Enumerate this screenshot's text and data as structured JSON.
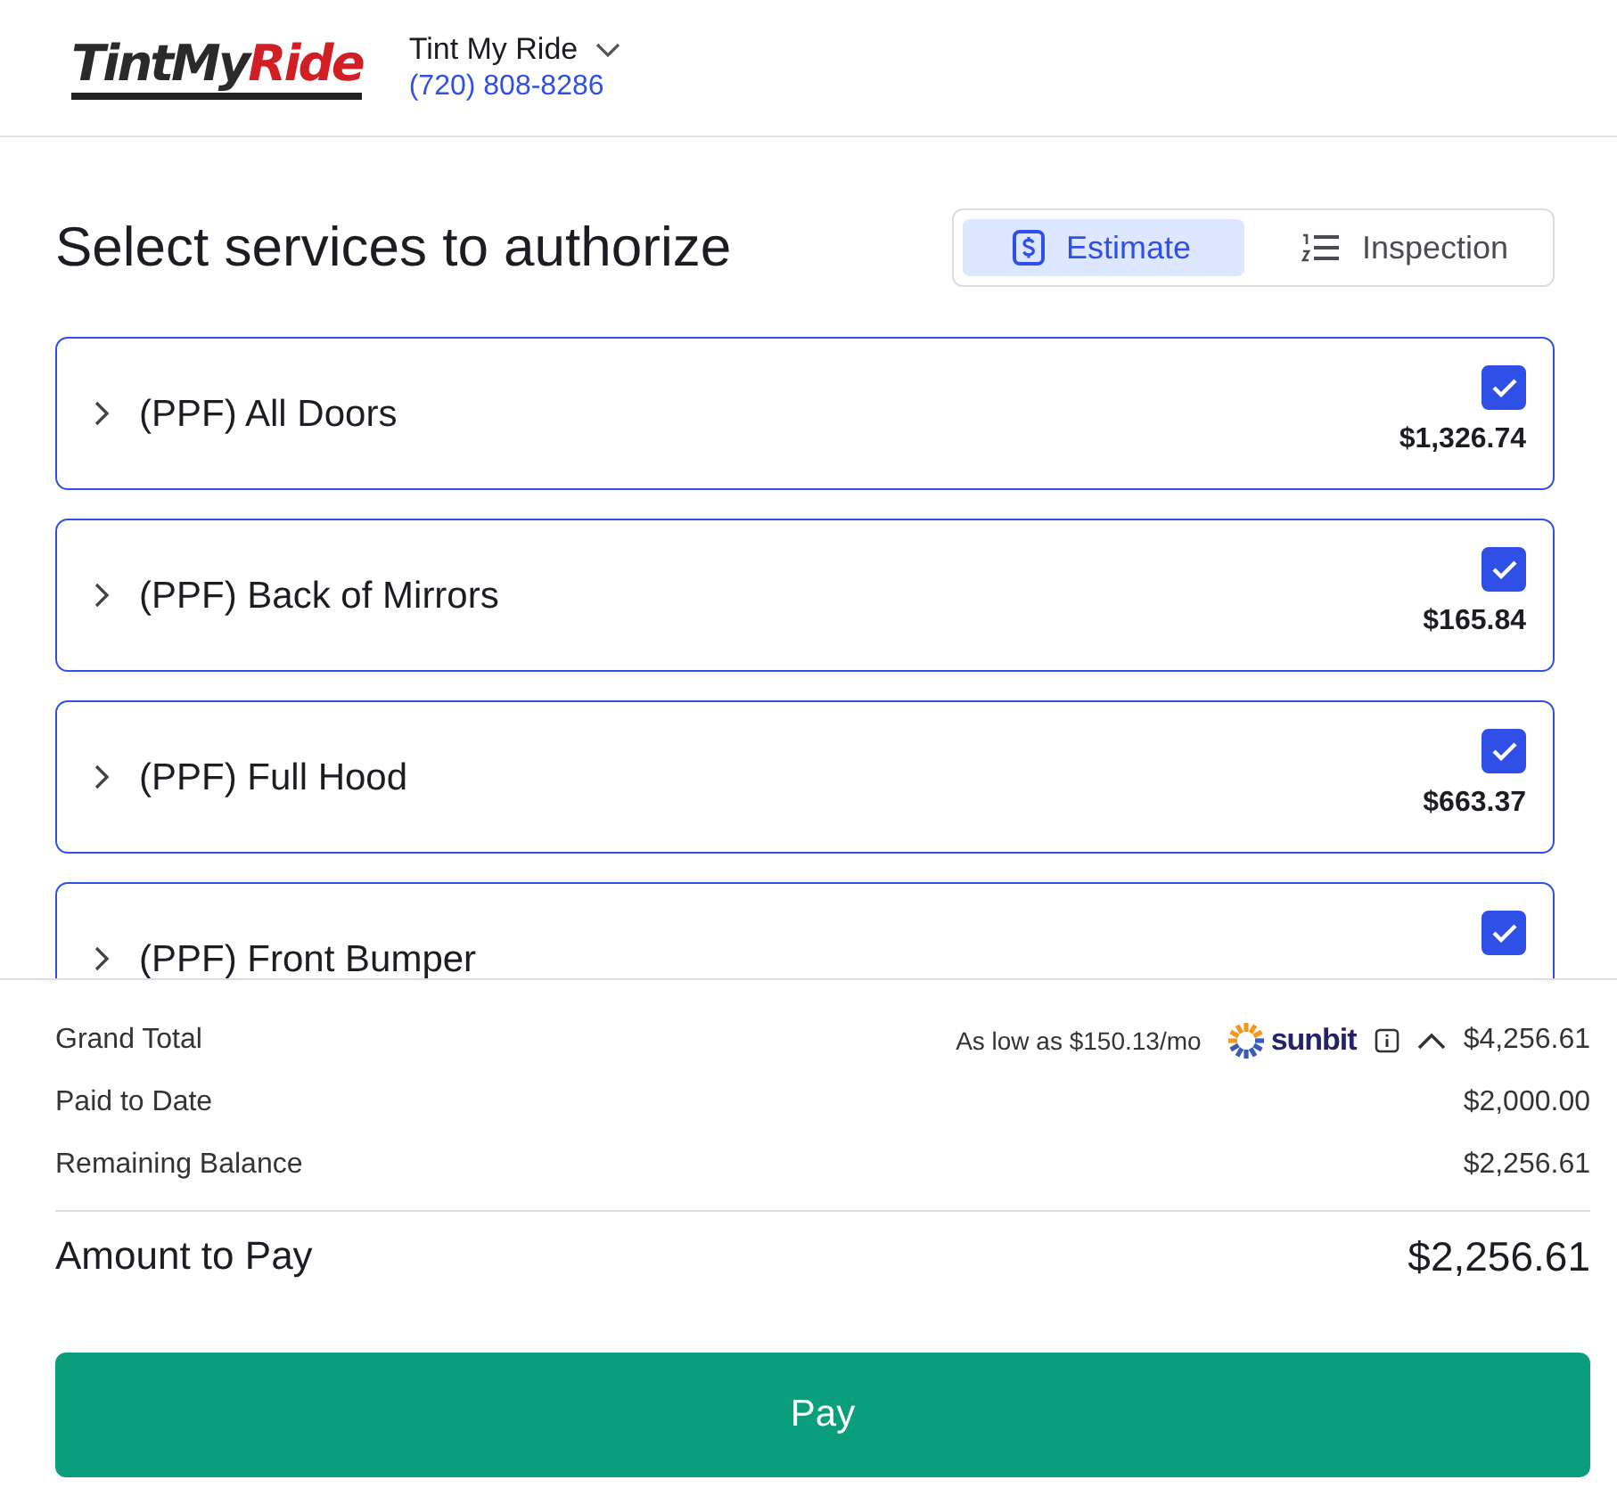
{
  "header": {
    "logo": {
      "part_1": "TintMy",
      "part_2": "Ride"
    },
    "shop_name": "Tint My Ride",
    "phone": "(720) 808-8286"
  },
  "title": "Select services to authorize",
  "tabs": [
    {
      "label": "Estimate",
      "kind": "estimate",
      "selected": true
    },
    {
      "label": "Inspection",
      "kind": "inspection",
      "selected": false
    }
  ],
  "services": [
    {
      "name": "(PPF) All Doors",
      "price": "$1,326.74",
      "checked": true,
      "expanded": false
    },
    {
      "name": "(PPF) Back of Mirrors",
      "price": "$165.84",
      "checked": true,
      "expanded": false
    },
    {
      "name": "(PPF) Full Hood",
      "price": "$663.37",
      "checked": true,
      "expanded": false
    },
    {
      "name": "(PPF) Front Bumper",
      "checked": true,
      "expanded": false
    }
  ],
  "totals": {
    "grand_total": {
      "label": "Grand Total",
      "financing": "As low as $150.13/mo",
      "financing_brand": "sunbit",
      "value": "$4,256.61",
      "expanded": true
    },
    "rows": [
      {
        "label": "Paid to Date",
        "value": "$2,000.00"
      },
      {
        "label": "Remaining Balance",
        "value": "$2,256.61"
      }
    ],
    "amount_to_pay": {
      "label": "Amount to Pay",
      "value": "$2,256.61"
    }
  },
  "pay_button": "Pay"
}
